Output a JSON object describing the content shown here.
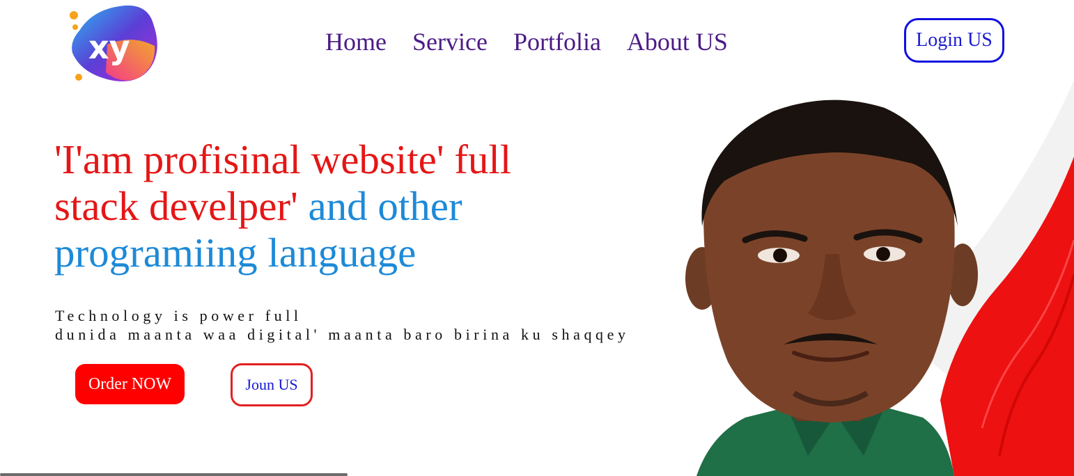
{
  "logo": {
    "text": "xy",
    "icon": "xy-logo-icon"
  },
  "nav": {
    "items": [
      {
        "label": "Home"
      },
      {
        "label": "Service"
      },
      {
        "label": "Portfolia"
      },
      {
        "label": "About US"
      }
    ],
    "login_label": "Login US"
  },
  "hero": {
    "headline_red_line1": "'I'am profisinal website' full",
    "headline_red_line2": "stack develper'",
    "headline_blue_line2": " and other",
    "headline_blue_line3": "programiing language",
    "tagline_line1": "Technology is power full",
    "tagline_line2": "dunida maanta waa digital' maanta baro birina ku shaqqey",
    "order_label": "Order NOW",
    "join_label": "Joun US",
    "photo": "portrait-photo"
  },
  "colors": {
    "nav_text": "#4b1a86",
    "headline_red": "#e51616",
    "headline_blue": "#1d8ad8",
    "order_bg": "#ff0000",
    "accent_swoosh": "#ee1111",
    "login_border": "#0f0fe0"
  }
}
